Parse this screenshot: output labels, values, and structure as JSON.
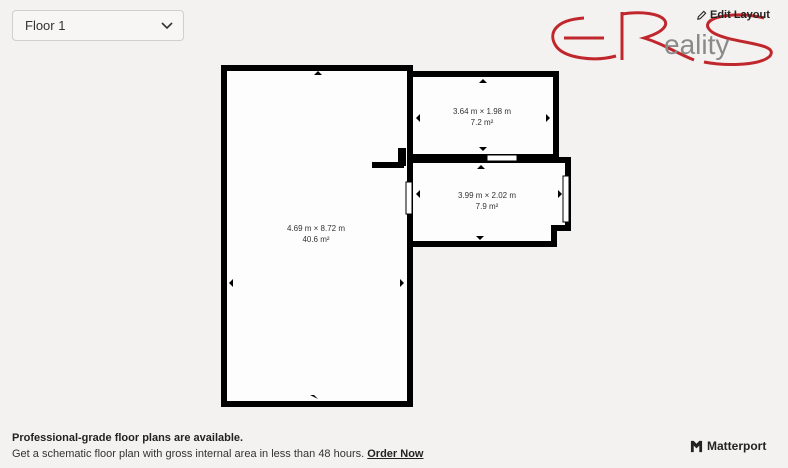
{
  "floor_selector": {
    "value": "Floor 1"
  },
  "logo": {
    "text": "ERS Reality",
    "colors": {
      "primary": "#c0272d",
      "secondary": "#8a8a8a"
    }
  },
  "edit_layout": {
    "label": "Edit Layout",
    "icon": "pencil-icon"
  },
  "rooms": [
    {
      "dims": "4.69 m × 8.72 m",
      "area": "40.6 m²"
    },
    {
      "dims": "3.64 m × 1.98 m",
      "area": "7.2 m²"
    },
    {
      "dims": "3.99 m × 2.02 m",
      "area": "7.9 m²"
    }
  ],
  "promo": {
    "title": "Professional-grade floor plans are available.",
    "subtitle": "Get a schematic floor plan with gross internal area in less than 48 hours.",
    "link": "Order Now"
  },
  "brand": {
    "name": "Matterport",
    "icon": "matterport-icon"
  }
}
